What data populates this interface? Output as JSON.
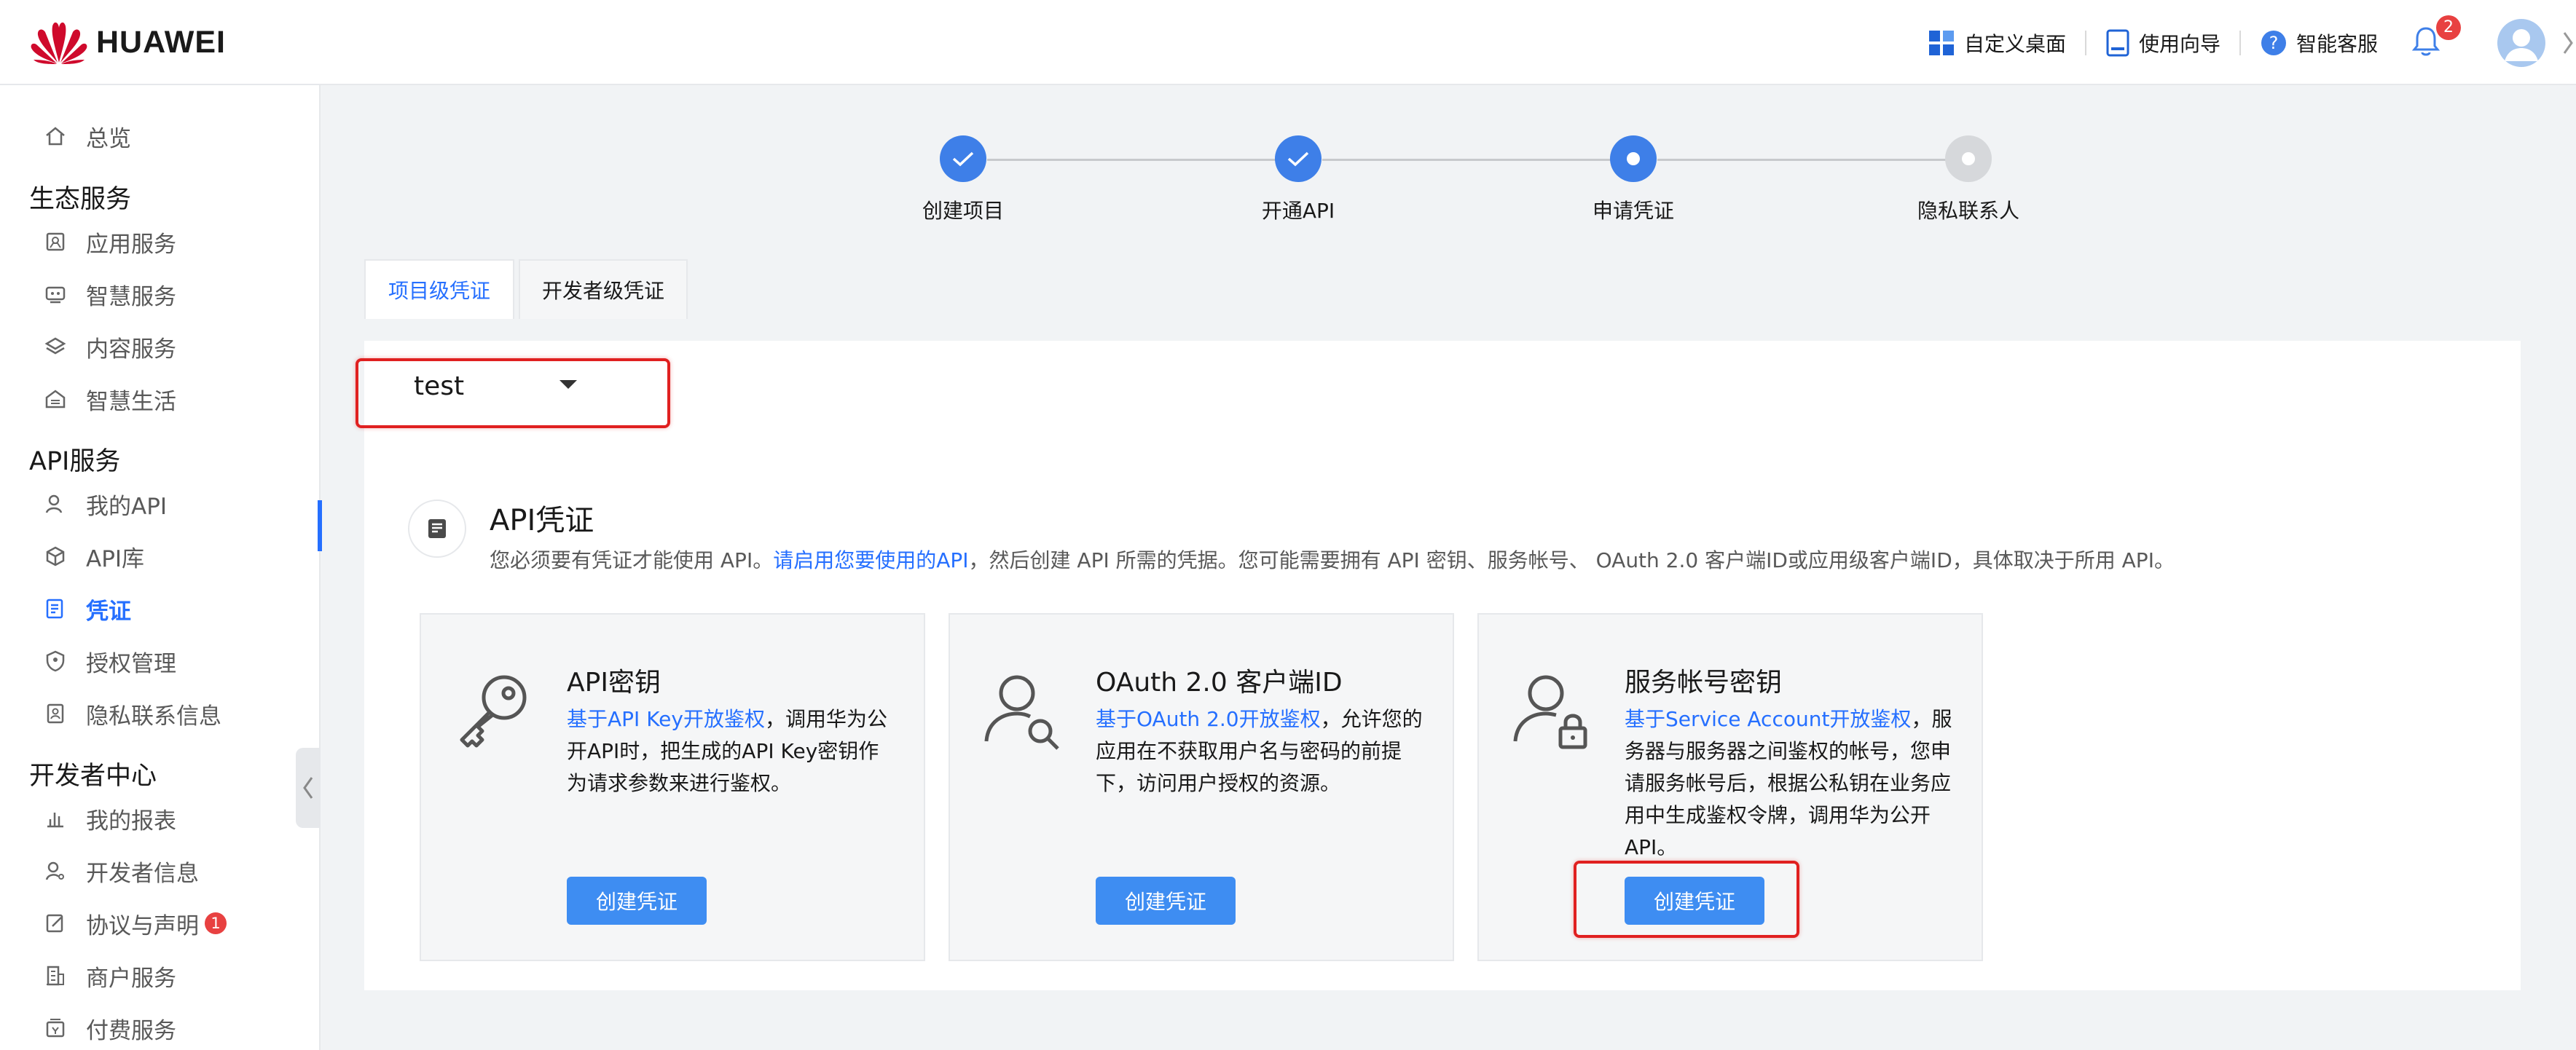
{
  "header": {
    "brand": "HUAWEI",
    "customize_label": "自定义桌面",
    "guide_label": "使用向导",
    "support_label": "智能客服",
    "notification_count": "2"
  },
  "sidebar": {
    "overview": "总览",
    "groups": [
      {
        "title": "生态服务",
        "items": [
          "应用服务",
          "智慧服务",
          "内容服务",
          "智慧生活"
        ]
      },
      {
        "title": "API服务",
        "items": [
          "我的API",
          "API库",
          "凭证",
          "授权管理",
          "隐私联系信息"
        ]
      },
      {
        "title": "开发者中心",
        "items": [
          "我的报表",
          "开发者信息",
          "协议与声明",
          "商户服务",
          "付费服务"
        ]
      }
    ],
    "active_item": "凭证",
    "agreement_badge": "1"
  },
  "stepper": {
    "steps": [
      {
        "label": "创建项目",
        "state": "done"
      },
      {
        "label": "开通API",
        "state": "done"
      },
      {
        "label": "申请凭证",
        "state": "current"
      },
      {
        "label": "隐私联系人",
        "state": "todo"
      }
    ]
  },
  "tabs": [
    {
      "label": "项目级凭证",
      "active": true
    },
    {
      "label": "开发者级凭证",
      "active": false
    }
  ],
  "project_select": {
    "value": "test"
  },
  "section": {
    "title": "API凭证",
    "desc_prefix": "您必须要有凭证才能使用 API。",
    "desc_link": "请启用您要使用的API",
    "desc_suffix": "，然后创建 API 所需的凭据。您可能需要拥有 API 密钥、服务帐号、 OAuth 2.0 客户端ID或应用级客户端ID，具体取决于所用 API。"
  },
  "cards": [
    {
      "title": "API密钥",
      "link": "基于API Key开放鉴权",
      "text": "，调用华为公开API时，把生成的API Key密钥作为请求参数来进行鉴权。",
      "button": "创建凭证",
      "icon": "key-icon"
    },
    {
      "title": "OAuth 2.0 客户端ID",
      "link": "基于OAuth 2.0开放鉴权",
      "text": "，允许您的应用在不获取用户名与密码的前提下，访问用户授权的资源。",
      "button": "创建凭证",
      "icon": "user-search-icon"
    },
    {
      "title": "服务帐号密钥",
      "link": "基于Service Account开放鉴权",
      "text": "，服务器与服务器之间鉴权的帐号，您申请服务帐号后，根据公私钥在业务应用中生成鉴权令牌，调用华为公开API。",
      "button": "创建凭证",
      "icon": "user-lock-icon"
    }
  ],
  "colors": {
    "accent": "#256fff",
    "button": "#3e8df2",
    "highlight": "#e02020"
  }
}
